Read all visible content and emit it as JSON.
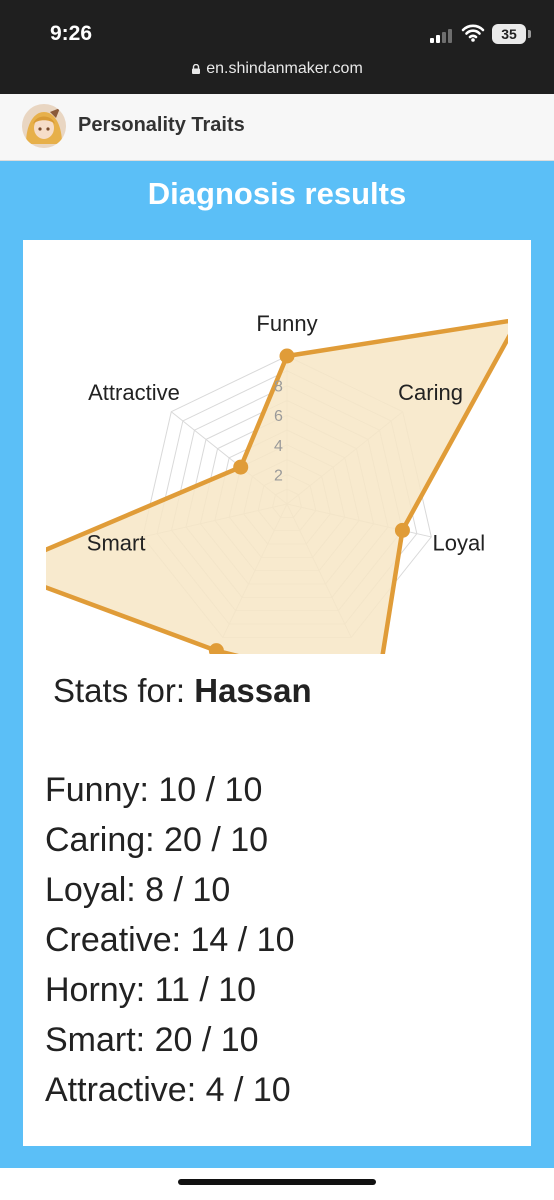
{
  "status_bar": {
    "time": "9:26",
    "battery": "35",
    "url": "en.shindanmaker.com"
  },
  "header": {
    "title": "Personality Traits"
  },
  "results": {
    "heading": "Diagnosis results",
    "stats_prefix": "Stats for:",
    "name": "Hassan"
  },
  "chart_data": {
    "type": "radar",
    "categories": [
      "Funny",
      "Caring",
      "Loyal",
      "Creative",
      "Horny",
      "Smart",
      "Attractive"
    ],
    "series": [
      {
        "values": [
          10,
          20,
          8,
          14,
          11,
          20,
          4
        ]
      }
    ],
    "ticks": [
      "2",
      "4",
      "6",
      "8"
    ],
    "rlim": [
      0,
      10
    ],
    "grid": true,
    "colors": {
      "line": "#e09c38",
      "fill": "#f7e6c6",
      "grid": "#d9d9d9",
      "tick": "#9a9a9a"
    }
  },
  "stats": [
    {
      "line": "Funny: 10 / 10"
    },
    {
      "line": "Caring: 20 / 10"
    },
    {
      "line": "Loyal: 8 / 10"
    },
    {
      "line": "Creative: 14 / 10"
    },
    {
      "line": "Horny: 11 / 10"
    },
    {
      "line": "Smart: 20 / 10"
    },
    {
      "line": "Attractive: 4 / 10"
    }
  ]
}
